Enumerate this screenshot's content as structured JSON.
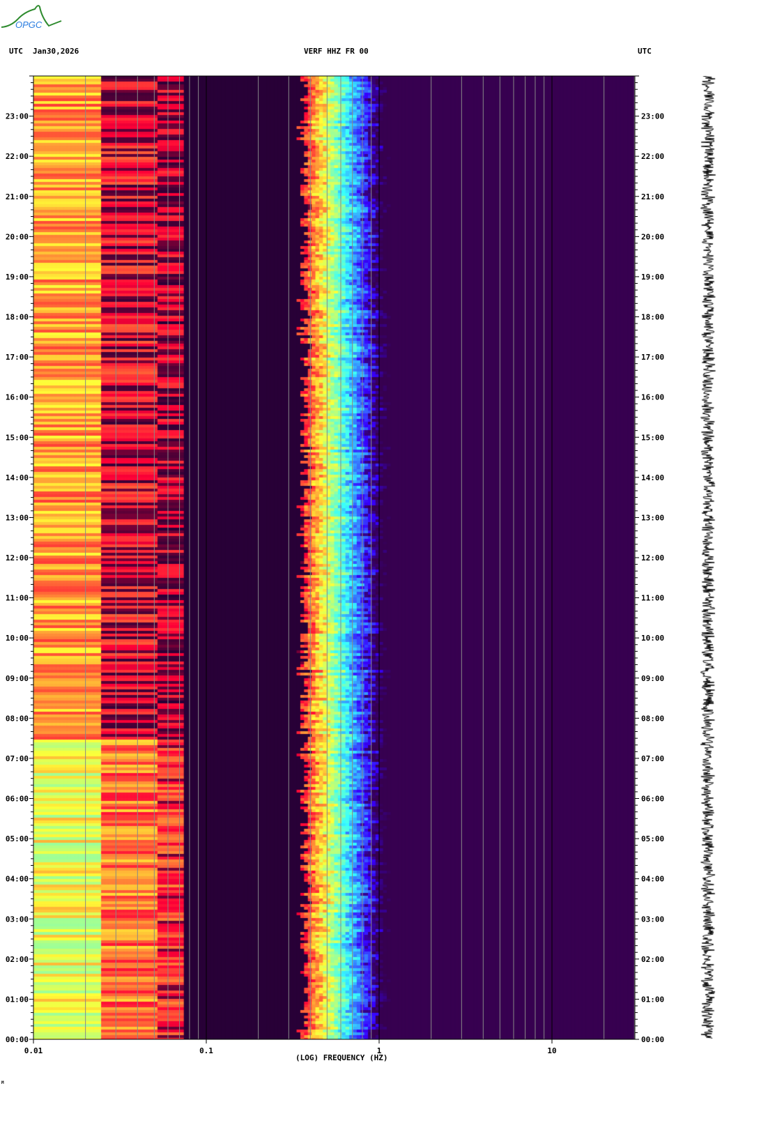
{
  "header": {
    "logo_text": "OPGC",
    "left_tz": "UTC",
    "date": "Jan30,2026",
    "station": "VERF HHZ FR 00",
    "right_tz": "UTC"
  },
  "footer_mark": "M",
  "chart_data": {
    "type": "heatmap",
    "title": "VERF HHZ FR 00",
    "subtitle": "Jan30,2026",
    "xlabel": "(LOG) FREQUENCY (HZ)",
    "ylabel": "UTC",
    "xscale": "log",
    "xlim": [
      0.01,
      30
    ],
    "x_ticks": [
      "0.01",
      "0.1",
      "1",
      "10"
    ],
    "x_tick_values": [
      0.01,
      0.1,
      1,
      10
    ],
    "ylim_hours": [
      0,
      24
    ],
    "y_ticks": [
      "00:00",
      "01:00",
      "02:00",
      "03:00",
      "04:00",
      "05:00",
      "06:00",
      "07:00",
      "08:00",
      "09:00",
      "10:00",
      "11:00",
      "12:00",
      "13:00",
      "14:00",
      "15:00",
      "16:00",
      "17:00",
      "18:00",
      "19:00",
      "20:00",
      "21:00",
      "22:00",
      "23:00"
    ],
    "colormap": "jet",
    "description_bands": [
      {
        "freq_range_hz": [
          0.01,
          0.024
        ],
        "level": "medium-high (yellow/green, greener 00-07h)"
      },
      {
        "freq_range_hz": [
          0.024,
          0.05
        ],
        "level": "high (red, orange/yellow 00-07h)"
      },
      {
        "freq_range_hz": [
          0.05,
          0.072
        ],
        "level": "high (dark red/orange)"
      },
      {
        "freq_range_hz": [
          0.072,
          0.3
        ],
        "level": "saturated (dark red)"
      },
      {
        "freq_range_hz": [
          0.3,
          0.9
        ],
        "level": "decreasing (red to cyan to blue)"
      },
      {
        "freq_range_hz": [
          0.9,
          30
        ],
        "level": "low (dark blue)"
      }
    ],
    "grid": true
  }
}
